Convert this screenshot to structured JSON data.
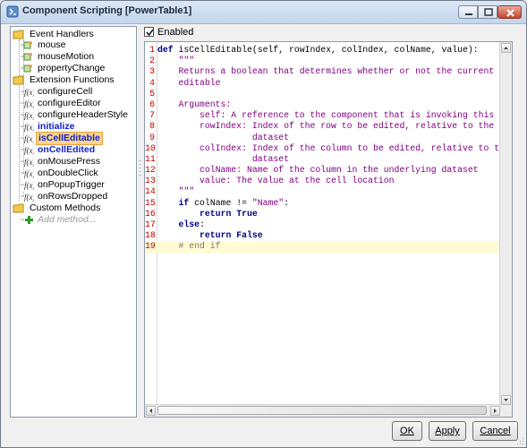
{
  "window": {
    "title": "Component Scripting [PowerTable1]",
    "controls": [
      "minimize-icon",
      "maximize-icon",
      "close-icon"
    ]
  },
  "tree": {
    "event_handlers": {
      "label": "Event Handlers",
      "items": [
        {
          "label": "mouse"
        },
        {
          "label": "mouseMotion"
        },
        {
          "label": "propertyChange"
        }
      ]
    },
    "extension_functions": {
      "label": "Extension Functions",
      "items": [
        {
          "label": "configureCell"
        },
        {
          "label": "configureEditor"
        },
        {
          "label": "configureHeaderStyle"
        },
        {
          "label": "initialize"
        },
        {
          "label": "isCellEditable"
        },
        {
          "label": "onCellEdited"
        },
        {
          "label": "onMousePress"
        },
        {
          "label": "onDoubleClick"
        },
        {
          "label": "onPopupTrigger"
        },
        {
          "label": "onRowsDropped"
        }
      ]
    },
    "custom_methods": {
      "label": "Custom Methods",
      "add_label": "Add method..."
    },
    "function_icon_text": "f(x)"
  },
  "enabled": {
    "label": "Enabled",
    "checked": true
  },
  "editor": {
    "lines": [
      {
        "n": "1",
        "text": "def isCellEditable(self, rowIndex, colIndex, colName, value):"
      },
      {
        "n": "2",
        "text": "\t\"\"\""
      },
      {
        "n": "3",
        "text": "\tReturns a boolean that determines whether or not the current cell is"
      },
      {
        "n": "4",
        "text": "\teditable"
      },
      {
        "n": "5",
        "text": ""
      },
      {
        "n": "6",
        "text": "\tArguments:"
      },
      {
        "n": "7",
        "text": "\t\tself: A reference to the component that is invoking this function."
      },
      {
        "n": "8",
        "text": "\t\trowIndex: Index of the row to be edited, relative to the underlying"
      },
      {
        "n": "9",
        "text": "\t\t          dataset"
      },
      {
        "n": "10",
        "text": "\t\tcolIndex: Index of the column to be edited, relative to the underlyin"
      },
      {
        "n": "11",
        "text": "\t\t          dataset"
      },
      {
        "n": "12",
        "text": "\t\tcolName: Name of the column in the underlying dataset"
      },
      {
        "n": "13",
        "text": "\t\tvalue: The value at the cell location"
      },
      {
        "n": "14",
        "text": "\t\"\"\""
      },
      {
        "n": "15",
        "text": "\tif colName != \"Name\":"
      },
      {
        "n": "16",
        "text": "\t\treturn True"
      },
      {
        "n": "17",
        "text": "\telse:"
      },
      {
        "n": "18",
        "text": "\t\treturn False"
      },
      {
        "n": "19",
        "text": "\t# end if"
      }
    ]
  },
  "buttons": {
    "ok": "OK",
    "apply": "Apply",
    "cancel": "Cancel"
  },
  "colors": {
    "selection_bg": "#fcd38b",
    "bold_item": "#1020d0",
    "line_number": "#c00000",
    "keyword": "#000080",
    "string": "#800080",
    "comment": "#7a7a7a",
    "current_line": "#fffbd3"
  }
}
